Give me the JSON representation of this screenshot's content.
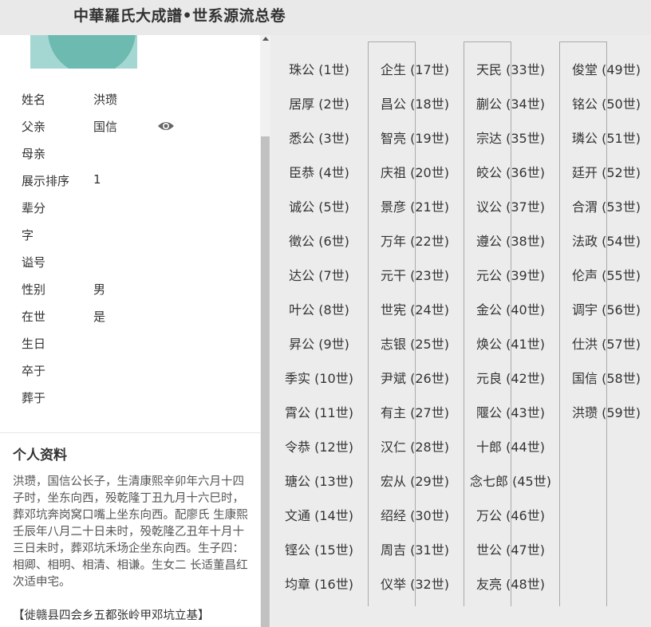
{
  "header": {
    "title": "中華羅氏大成譜•世系源流总卷"
  },
  "person": {
    "fields": [
      {
        "label": "姓名",
        "value": "洪瓒"
      },
      {
        "label": "父亲",
        "value": "国信"
      },
      {
        "label": "母亲",
        "value": ""
      },
      {
        "label": "展示排序",
        "value": "1"
      },
      {
        "label": "辈分",
        "value": ""
      },
      {
        "label": "字",
        "value": ""
      },
      {
        "label": "谥号",
        "value": ""
      },
      {
        "label": "性别",
        "value": "男"
      },
      {
        "label": "在世",
        "value": "是"
      },
      {
        "label": "生日",
        "value": ""
      },
      {
        "label": "卒于",
        "value": ""
      },
      {
        "label": "葬于",
        "value": ""
      }
    ],
    "eye_icon": "eye-icon"
  },
  "bio": {
    "title": "个人资料",
    "text": "洪瓒，国信公长子，生清康熙辛卯年六月十四子时，坐东向西，殁乾隆丁丑九月十六巳时，葬邓坑奔岗窝口嘴上坐东向西。配廖氏 生康熙壬辰年八月二十日未时，殁乾隆乙丑年十月十三日未时，葬邓坑禾场企坐东向西。生子四：相卿、相明、相清、相谦。生女二 长适董昌红 次适申宅。",
    "footer": "【徙赣县四会乡五都张岭甲邓坑立基】"
  },
  "generations": [
    [
      "珠公 (1世)",
      "居厚 (2世)",
      "悉公 (3世)",
      "臣恭 (4世)",
      "诚公 (5世)",
      "徵公 (6世)",
      "达公 (7世)",
      "叶公 (8世)",
      "昇公 (9世)",
      "季实 (10世)",
      "霄公 (11世)",
      "令恭 (12世)",
      "瑭公 (13世)",
      "文通 (14世)",
      "铿公 (15世)",
      "均章 (16世)"
    ],
    [
      "企生 (17世)",
      "昌公 (18世)",
      "智亮 (19世)",
      "庆祖 (20世)",
      "景彦 (21世)",
      "万年 (22世)",
      "元干 (23世)",
      "世宪 (24世)",
      "志银 (25世)",
      "尹斌 (26世)",
      "有主 (27世)",
      "汉仁 (28世)",
      "宏从 (29世)",
      "绍经 (30世)",
      "周吉 (31世)",
      "仪举 (32世)"
    ],
    [
      "天民 (33世)",
      "蒯公 (34世)",
      "宗达 (35世)",
      "皎公 (36世)",
      "议公 (37世)",
      "遵公 (38世)",
      "元公 (39世)",
      "金公 (40世)",
      "焕公 (41世)",
      "元良 (42世)",
      "隁公 (43世)",
      "十郎 (44世)",
      "念七郎 (45世)",
      "万公 (46世)",
      "世公 (47世)",
      "友亮 (48世)"
    ],
    [
      "俊堂 (49世)",
      "铭公 (50世)",
      "璘公 (51世)",
      "廷开 (52世)",
      "合渭 (53世)",
      "法政 (54世)",
      "伦声 (55世)",
      "调宇 (56世)",
      "仕洪 (57世)",
      "国信 (58世)",
      "洪瓒 (59世)"
    ]
  ],
  "colors": {
    "accent_photo": "#a5d7d2",
    "background": "#ececec"
  }
}
